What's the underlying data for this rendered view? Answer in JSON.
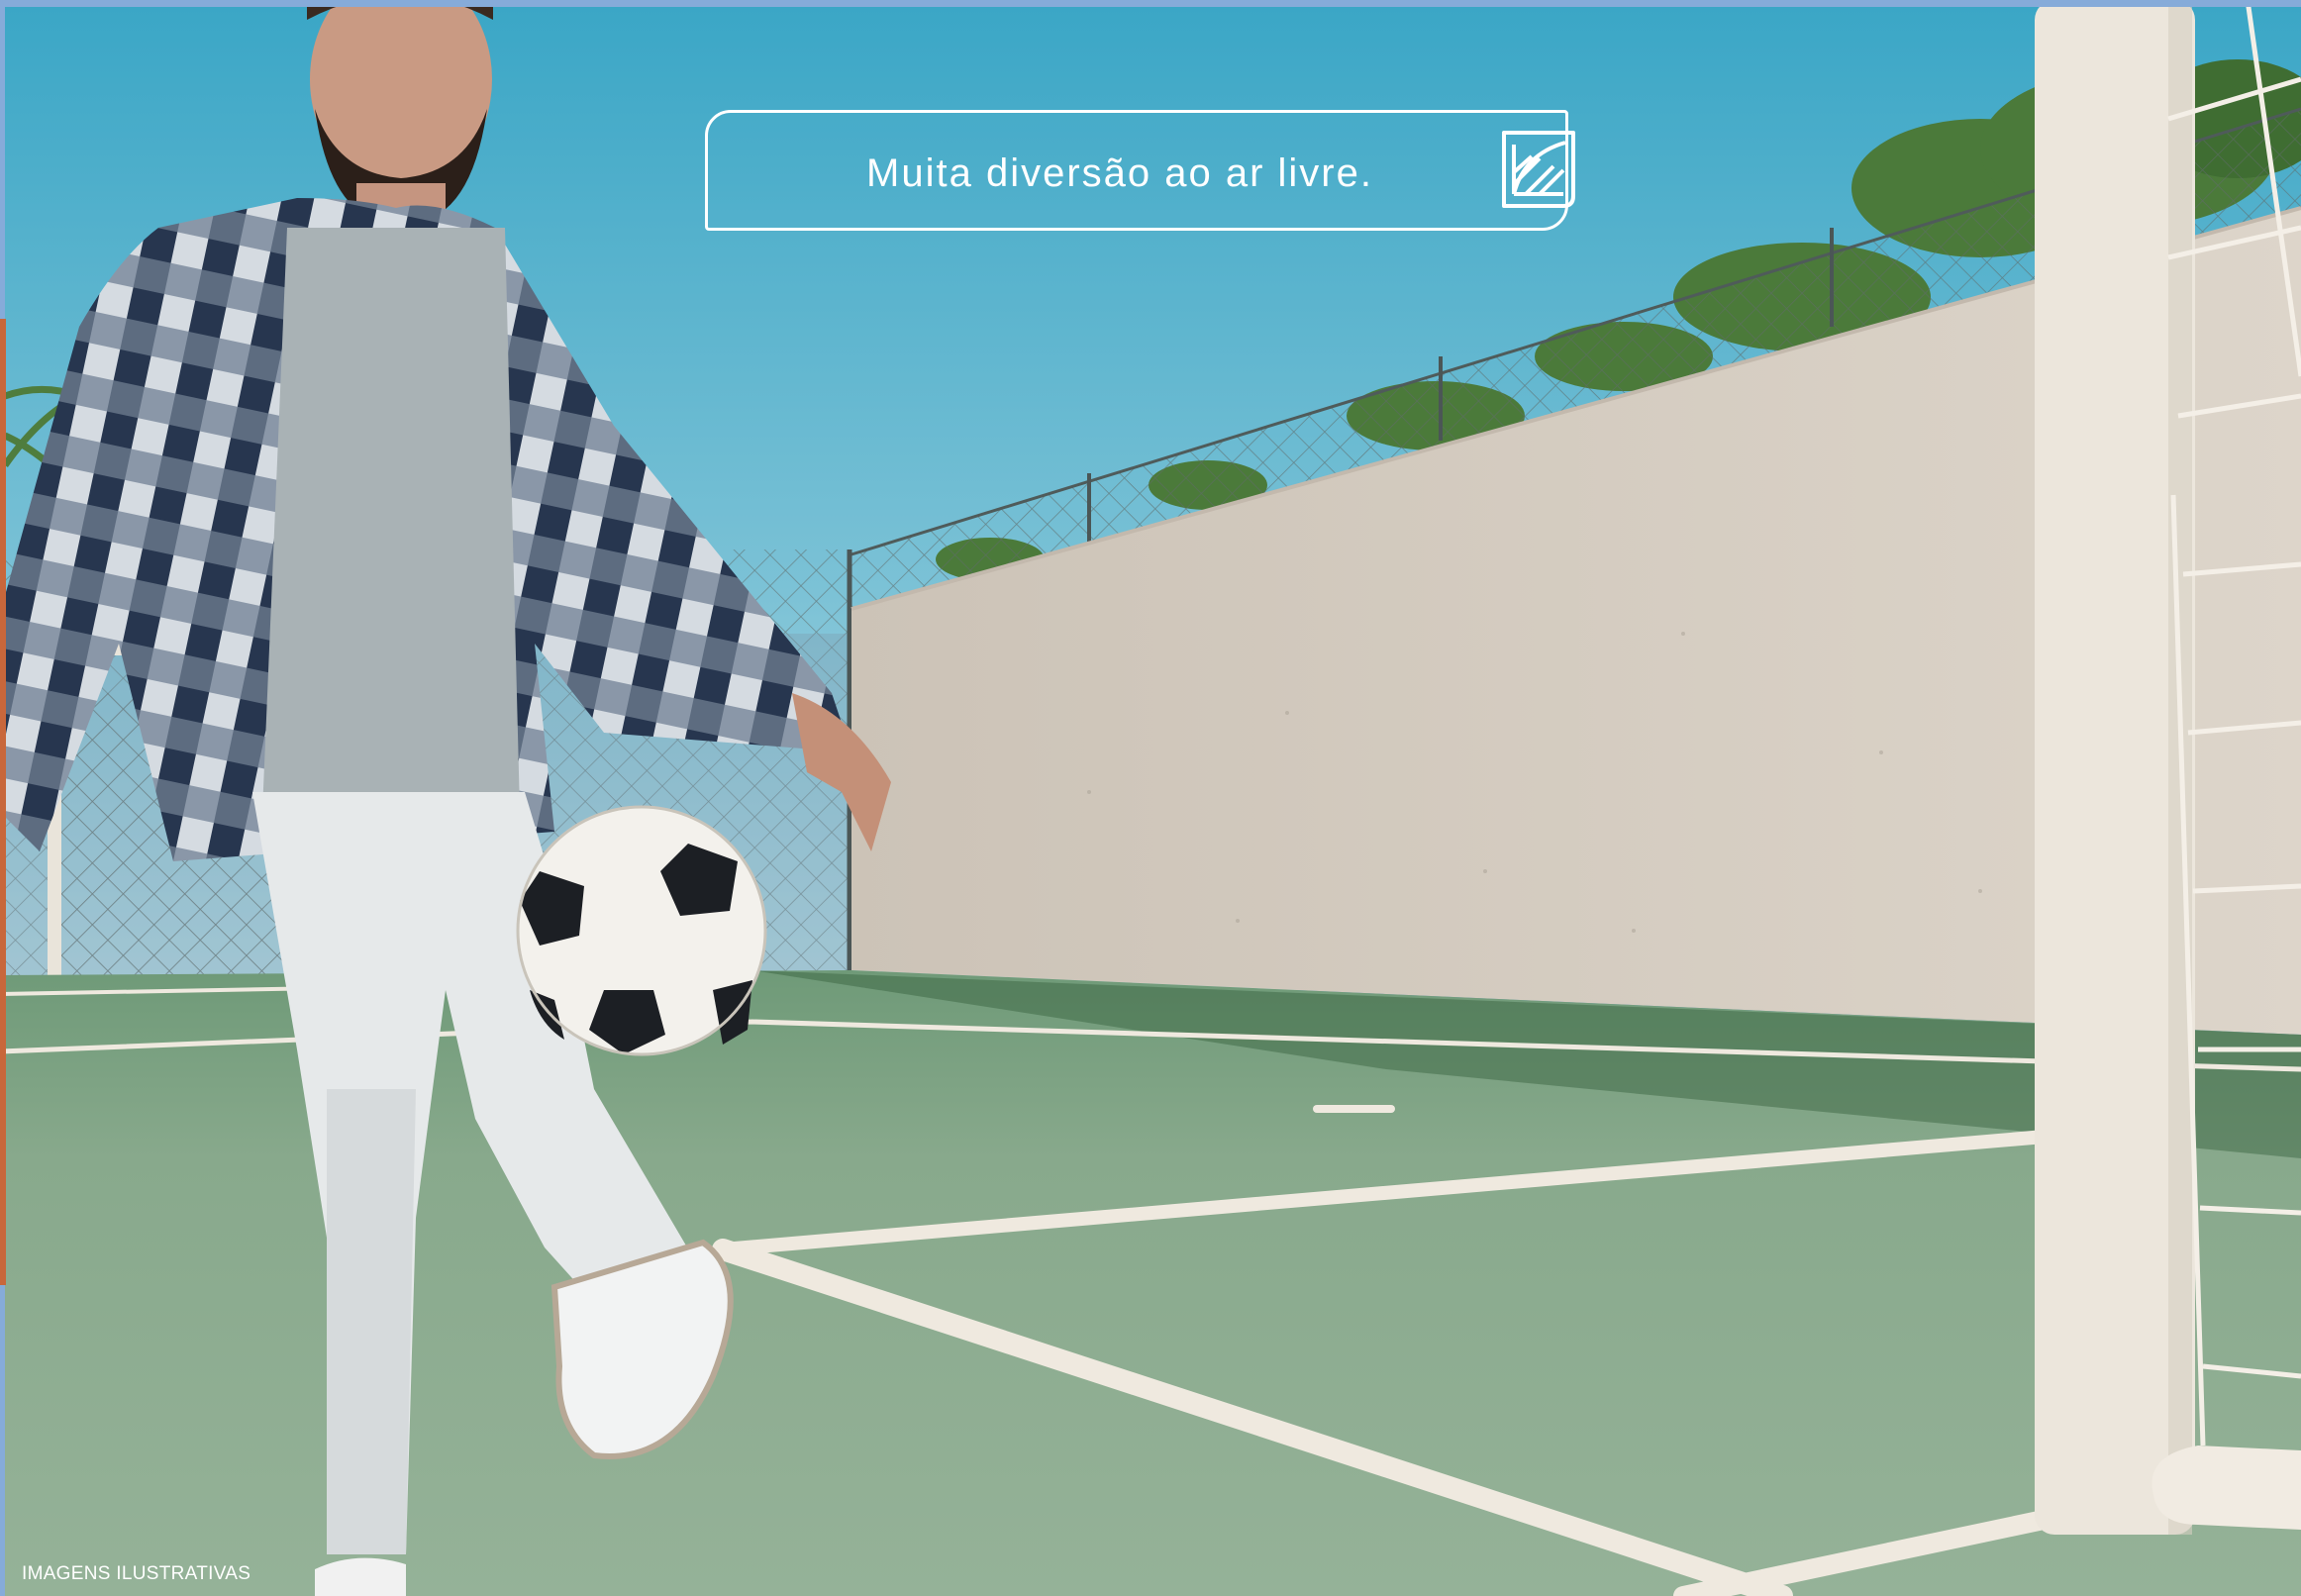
{
  "caption": {
    "text": "Muita diversão ao ar livre."
  },
  "disclaimer": {
    "text": "IMAGENS ILUSTRATIVAS"
  },
  "icons": {
    "brand": "leaf-square-logo-icon"
  },
  "colors": {
    "sky_top": "#3fa9c7",
    "sky_bottom": "#9fd4e0",
    "wall": "#d7cfc4",
    "court_green": "#8aa88e",
    "court_line": "#f1ece4",
    "accent_orange": "#c8673b",
    "frame_blue": "#86abd9"
  }
}
